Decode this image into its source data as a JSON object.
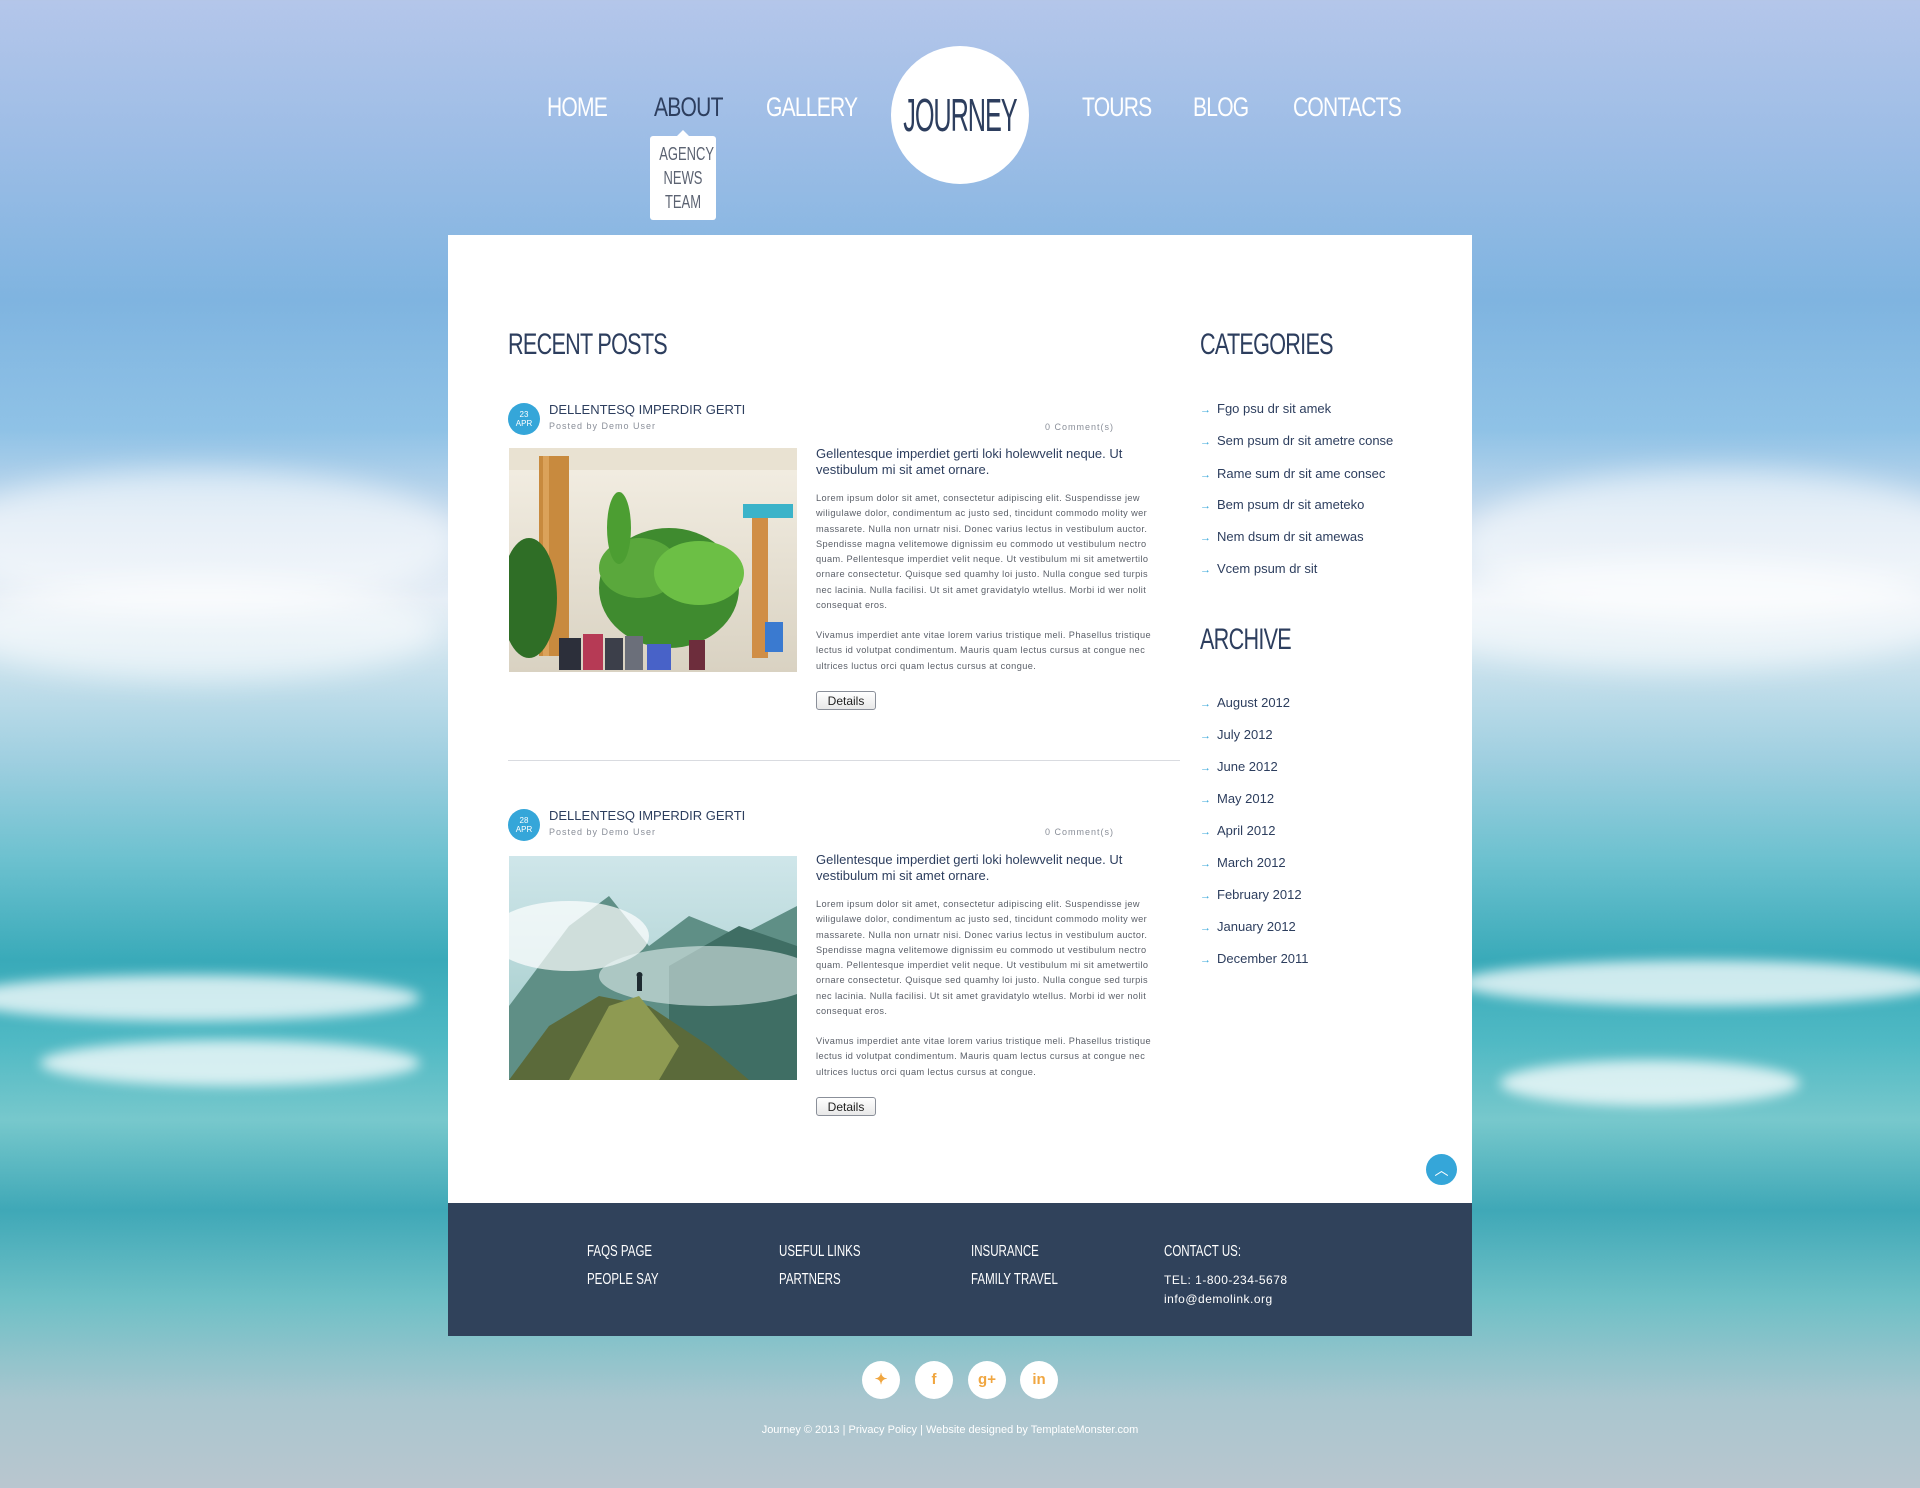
{
  "nav": {
    "home": "HOME",
    "about": "ABOUT",
    "gallery": "GALLERY",
    "logo": "JOURNEY",
    "tours": "TOURS",
    "blog": "BLOG",
    "contacts": "CONTACTS",
    "about_submenu": [
      "AGENCY",
      "NEWS",
      "TEAM"
    ]
  },
  "recent_posts": {
    "heading": "RECENT POSTS",
    "posts": [
      {
        "day": "23",
        "month": "APR",
        "title": "DELLENTESQ IMPERDIR GERTI",
        "author": "Posted by Demo User",
        "comments": "0 Comment(s)",
        "lead": "Gellentesque imperdiet gerti loki holewvelit neque. Ut vestibulum mi sit amet ornare.",
        "text1": "Lorem ipsum dolor sit amet, consectetur adipiscing elit. Suspendisse jew wiligulawe dolor, condimentum ac justo sed, tincidunt commodo molity wer massarete. Nulla non urnatr nisi. Donec varius lectus in vestibulum auctor. Spendisse magna velitemowe dignissim eu commodo ut vestibulum nectro quam. Pellentesque imperdiet velit neque. Ut vestibulum mi sit ametwertilo ornare consectetur. Quisque sed quamhy loi justo. Nulla congue sed turpis nec lacinia. Nulla facilisi. Ut sit amet gravidatylo wtellus. Morbi id wer nolit consequat eros.",
        "text2": "Vivamus imperdiet ante vitae lorem varius tristique meli. Phasellus tristique lectus id volutpat condimentum. Mauris quam lectus cursus at congue nec ultrices luctus orci quam lectus cursus at congue.",
        "button": "Details"
      },
      {
        "day": "28",
        "month": "APR",
        "title": "DELLENTESQ IMPERDIR GERTI",
        "author": "Posted by Demo User",
        "comments": "0 Comment(s)",
        "lead": "Gellentesque imperdiet gerti loki holewvelit neque. Ut vestibulum mi sit amet ornare.",
        "text1": "Lorem ipsum dolor sit amet, consectetur adipiscing elit. Suspendisse jew wiligulawe dolor, condimentum ac justo sed, tincidunt commodo molity wer massarete. Nulla non urnatr nisi. Donec varius lectus in vestibulum auctor. Spendisse magna velitemowe dignissim eu commodo ut vestibulum nectro quam. Pellentesque imperdiet velit neque. Ut vestibulum mi sit ametwertilo ornare consectetur. Quisque sed quamhy loi justo. Nulla congue sed turpis nec lacinia. Nulla facilisi. Ut sit amet gravidatylo wtellus. Morbi id wer nolit consequat eros.",
        "text2": "Vivamus imperdiet ante vitae lorem varius tristique meli. Phasellus tristique lectus id volutpat condimentum. Mauris quam lectus cursus at congue nec ultrices luctus orci quam lectus cursus at congue.",
        "button": "Details"
      }
    ]
  },
  "categories": {
    "heading": "CATEGORIES",
    "items": [
      "Fgo psu dr sit amek",
      "Sem psum dr sit ametre conse",
      "Rame sum dr sit ame consec",
      "Bem psum dr sit ameteko",
      "Nem dsum dr sit amewas",
      "Vcem psum dr sit"
    ]
  },
  "archive": {
    "heading": "ARCHIVE",
    "items": [
      "August 2012",
      "July 2012",
      "June 2012",
      "May 2012",
      "April 2012",
      "March 2012",
      "February 2012",
      "January 2012",
      "December 2011"
    ]
  },
  "footer": {
    "col1": [
      "FAQS PAGE",
      "PEOPLE SAY"
    ],
    "col2": [
      "USEFUL LINKS",
      "PARTNERS"
    ],
    "col3": [
      "INSURANCE",
      "FAMILY TRAVEL"
    ],
    "contact_heading": "CONTACT US:",
    "tel": "TEL: 1-800-234-5678",
    "email": "info@demolink.org"
  },
  "social": {
    "twitter": "twitter-icon",
    "facebook": "facebook-icon",
    "google_plus": "google-plus-icon",
    "linkedin": "linkedin-icon"
  },
  "copyright": {
    "brand": "Journey © 2013 | ",
    "privacy": "Privacy Policy",
    "separator": " | ",
    "designed": "Website designed by TemplateMonster.com"
  },
  "colors": {
    "accent": "#35a6d9",
    "navy": "#2d3e5e",
    "footer_bg": "#30425b",
    "social_icon": "#f0a640"
  }
}
